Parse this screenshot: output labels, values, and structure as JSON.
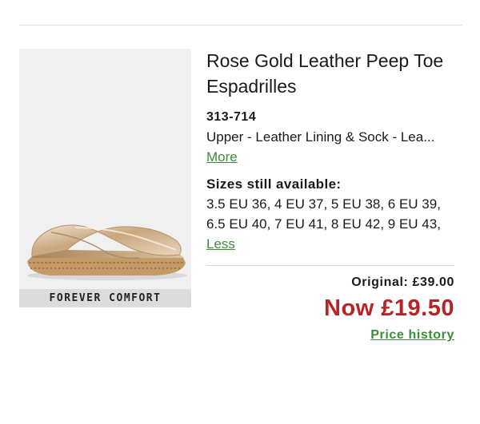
{
  "product": {
    "title": "Rose Gold Leather Peep Toe Espadrilles",
    "code": "313-714",
    "description": "Upper - Leather Lining & Sock - Lea...",
    "more_label": "More",
    "sizes_heading": "Sizes still available:",
    "sizes_text": "3.5 EU 36, 4 EU 37, 5 EU 38, 6 EU 39, 6.5 EU 40, 7 EU 41, 8 EU 42, 9 EU 43,",
    "less_label": "Less",
    "image_label": "FOREVER COMFORT"
  },
  "price": {
    "original": "Original: £39.00",
    "now": "Now £19.50",
    "history_label": "Price history"
  },
  "colors": {
    "sale_red": "#b82424",
    "link_green": "#3c8d3a"
  }
}
